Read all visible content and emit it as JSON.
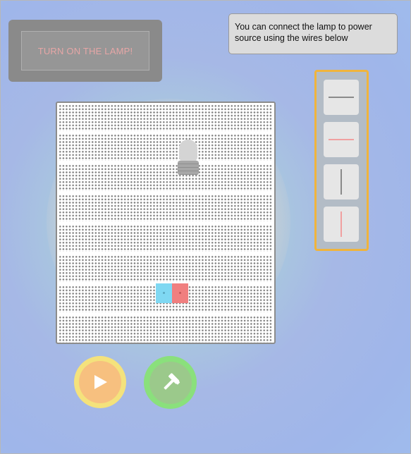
{
  "goal": {
    "text": "TURN ON THE LAMP!"
  },
  "hint": {
    "text": "You can connect the lamp to power source using the wires below"
  },
  "palette": {
    "border_color": "#f0b43c",
    "tiles": [
      {
        "name": "wire-horizontal-gray-tile",
        "orientation": "horizontal",
        "color": "#8a8a8a"
      },
      {
        "name": "wire-horizontal-pink-tile",
        "orientation": "horizontal",
        "color": "#f0a0a0"
      },
      {
        "name": "wire-vertical-gray-tile",
        "orientation": "vertical",
        "color": "#8a8a8a"
      },
      {
        "name": "wire-vertical-pink-tile",
        "orientation": "vertical",
        "color": "#f0a0a0"
      }
    ]
  },
  "board": {
    "icons": [
      "lamp-icon",
      "battery-icon"
    ],
    "battery_colors": {
      "negative": "#7fd8f2",
      "positive": "#f07f7f"
    }
  },
  "controls": {
    "play_icon": "play-icon",
    "build_icon": "hammer-icon",
    "play_color": "#f4e27c",
    "build_color": "#8ae07c"
  }
}
